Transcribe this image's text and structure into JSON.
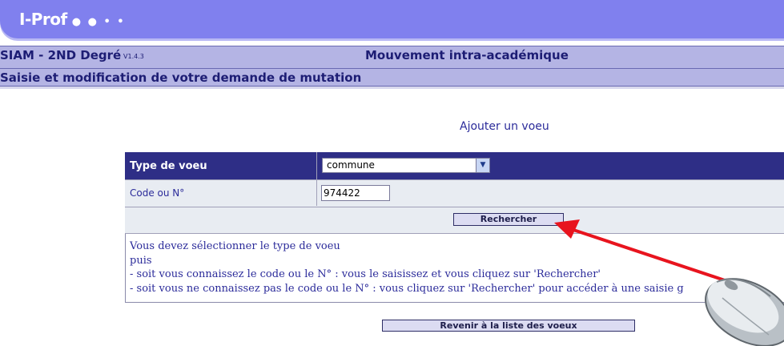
{
  "banner": {
    "title": "I-Prof",
    "dots": "● ● • •"
  },
  "app": {
    "name": "SIAM - 2ND Degré",
    "version": "V1.4.3",
    "section": "Mouvement intra-académique"
  },
  "subheader": "Saisie et modification de votre demande de mutation",
  "action_title": "Ajouter un voeu",
  "form": {
    "type_label": "Type de voeu",
    "type_value": "commune",
    "code_label": "Code ou N°",
    "code_value": "974422",
    "search_label": "Rechercher"
  },
  "help_lines": [
    "Vous devez sélectionner le type de voeu",
    "puis",
    "- soit vous connaissez le code ou le N° : vous le saisissez et vous cliquez sur 'Rechercher'",
    "- soit vous ne connaissez pas le code ou le N° : vous cliquez sur 'Rechercher' pour accéder à une saisie g"
  ],
  "back_label": "Revenir à la liste des voeux",
  "colors": {
    "banner": "#8080ee",
    "header_bar": "#b4b4e4",
    "table_head": "#2e2e86",
    "arrow": "#e8141e"
  },
  "icons": {
    "select": "chevron-down-icon",
    "pointer": "arrow-pointer-icon",
    "mouse": "computer-mouse-icon"
  }
}
